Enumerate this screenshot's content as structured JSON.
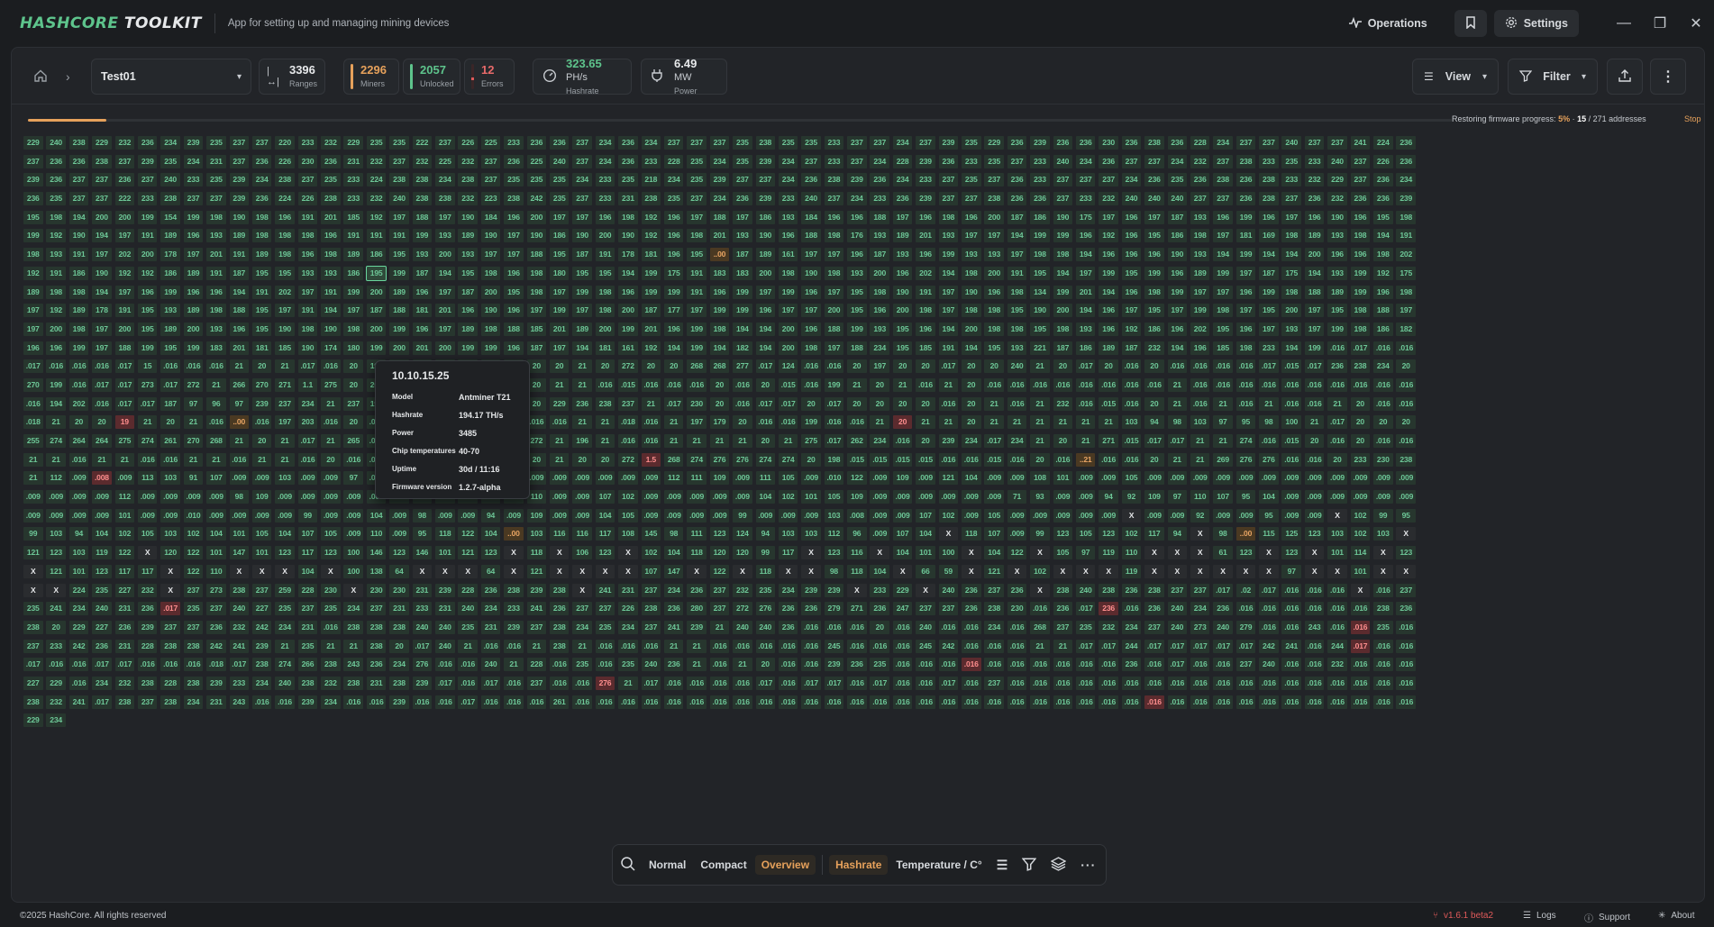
{
  "app": {
    "brand_a": "HASHCORE",
    "brand_b": "TOOLKIT",
    "subtitle": "App for setting up and managing mining devices"
  },
  "topbar": {
    "operations": "Operations",
    "settings": "Settings"
  },
  "header": {
    "project": "Test01",
    "ranges": {
      "num": "3396",
      "label": "Ranges"
    },
    "miners": {
      "num": "2296",
      "label": "Miners"
    },
    "unlocked": {
      "num": "2057",
      "label": "Unlocked"
    },
    "errors": {
      "num": "12",
      "label": "Errors"
    },
    "hashrate": {
      "num": "323.65",
      "unit": "PH/s",
      "label": "Hashrate"
    },
    "power": {
      "num": "6.49",
      "unit": "MW",
      "label": "Power"
    },
    "view": "View",
    "filter": "Filter"
  },
  "progress": {
    "label": "Restoring firmware progress:",
    "percent": "5%",
    "sep": "·",
    "done": "15",
    "total": "/ 271 addresses",
    "fraction": 0.05,
    "stop": "Stop"
  },
  "tooltip": {
    "ip": "10.10.15.25",
    "rows": [
      {
        "k": "Model",
        "v": "Antminer T21"
      },
      {
        "k": "Hashrate",
        "v": "194.17 TH/s"
      },
      {
        "k": "Power",
        "v": "3485"
      },
      {
        "k": "Chip temperatures",
        "v": "40-70"
      },
      {
        "k": "Uptime",
        "v": "30d / 11:16"
      },
      {
        "k": "Firmware version",
        "v": "1.2.7-alpha"
      }
    ]
  },
  "bottombar": {
    "normal": "Normal",
    "compact": "Compact",
    "overview": "Overview",
    "hashrate": "Hashrate",
    "temperature": "Temperature / C°"
  },
  "footer": {
    "copyright": "©2025 HashCore. All rights reserved",
    "version": "v1.6.1 beta2",
    "logs": "Logs",
    "support": "Support",
    "about": "About"
  },
  "grid_rows": [
    "229 240 238 229 232 236 234 239 235 237 237 220 233 232 229 235 235 222 237 226 225 233 236 236 237 234 236 234 237 237 237 235 238 235 235 233 237 237 234 237 239 235 229 236 239 236 236 230 236 238 236 228 234 237 237 240 237 237 241 224 236",
    "237 236 236 238 237 239 235 234 231 237 236 226 230 236 231 232 237 232 225 232 237 236 225 240 237 234 236 233 228 235 234 235 239 234 237 233 237 234 228 239 236 233 235 237 233 240 234 236 237 237 234 232 237 238 233 235 233 240 237 226 236",
    "239 236 237 237 236 237 240 233 235 239 234 238 237 235 233 224 238 238 234 238 237 235 235 235 234 233 235 218 234 235 239 237 237 234 236 238 239 236 234 233 237 235 237 236 233 237 237 237 234 236 235 236 238 236 238 233 232 229 237 236 234",
    "236 235 237 237 222 233 238 237 237 239 236 224 226 238 233 232 240 238 238 232 223 238 242 235 237 233 231 238 235 237 234 236 239 233 240 237 234 233 236 239 237 237 238 236 236 237 233 232 240 240 240 237 237 236 238 237 236 232 236 236 239",
    "195 198 194 200 200 199 154 199 198 190 198 196 191 201 185 192 197 188 197 190 184 196 200 197 197 196 198 192 196 197 188 197 186 193 184 196 196 188 197 196 198 196 200 187 186 190 175 197 196 197 187 193 196 199 196 197 196 190 196 195 198",
    "199 192 190 194 197 191 189 196 193 189 198 198 198 196 191 191 191 199 193 189 190 197 190 186 190 200 190 192 196 198 201 193 190 196 188 198 176 193 189 201 193 197 197 194 199 199 196 192 196 195 186 198 197 181 169 198 189 193 198 194 191",
    "198 193 191 197 202 200 178 197 201 191 189 198 196 198 189 186 195 193 200 193 197 197 188 195 187 191 178 181 196 195 ..00 187 189 161 197 197 196 187 193 196 199 193 193 197 198 198 194 196 196 196 190 193 194 199 194 194 200 196 196 198 202",
    "192 191 186 190 192 192 186 189 191 187 195 195 193 193 186 195 199 187 194 195 198 196 198 180 195 195 194 199 175 191 183 183 200 198 190 198 193 200 196 202 194 198 200 191 195 194 197 199 195 199 196 189 199 197 187 175 194 193 199 192 175",
    "189 198 198 194 197 196 199 196 196 194 191 202 197 191 199 200 189 196 197 187 200 195 198 197 199 198 196 199 199 191 196 199 197 199 196 197 195 198 190 191 197 190 196 198 134 199 201 194 196 198 199 197 197 196 199 198 188 189 199 196 198",
    "197 192 189 178 191 195 193 189 198 188 195 197 191 194 197 187 188 181 201 196 190 196 197 199 197 198 200 187 177 197 199 199 196 197 197 200 195 196 200 198 197 198 198 195 190 200 194 196 197 195 197 199 198 197 195 200 197 195 198 188 197",
    "197 200 198 197 200 195 189 200 193 196 195 190 198 190 198 200 199 196 197 189 198 188 185 201 189 200 199 201 196 199 198 194 194 200 196 188 199 193 195 196 194 200 198 198 195 198 193 196 192 186 196 202 195 196 197 193 197 199 198 186 182",
    "196 196 199 197 188 199 195 199 183 201 181 185 190 174 180 199 200 201 200 199 199 196 187 197 194 181 161 192 194 199 194 182 194 200 198 197 188 234 195 185 191 194 195 193 221 187 186 189 187 232 194 196 185 198 233 194 199 .016 .017 .016 .016",
    ".017 .016 .016 .016 .017 15 .016 .016 .016 21 20 21 .017 .016 20 192 .016 .017 .016 .017 192 .017 20 20 21 20 272 20 20 268 268 277 .017 124 .016 .016 20 197 20 20 .017 20 20 240 21 20 .017 20 .016 20 .016 .016 .016 .016 .017 .015 .017 236 238 234 20",
    "270 199 .016 .017 .017 273 .017 272 21 266 270 271 1.1 275 20 202 203 20 21 20 20 21 20 21 21 .016 .015 .016 .016 .016 20 .016 20 .015 .016 199 21 20 21 .016 21 20 .016 .016 .016 .016 .016 .016 .016 .016 21 .016 .016 .016 .016 .016 .016 .016 .016 .016 .016",
    ".016 194 202 .016 .017 .017 187 97 96 97 239 237 234 21 237 198 196 .016 .016 20 .017 .016 20 229 236 238 237 21 .017 230 20 .016 .017 .017 20 .017 20 20 20 20 .016 20 21 .016 21 232 .016 .015 .016 20 21 .016 21 .016 21 .016 .016 21 20 .016 .016",
    ".018 21 20 20 19 21 20 21 .016 ..00 .016 197 203 .016 20 .016 21 20 .017 20 .017 20 .016 .016 21 21 .018 .016 21 197 179 20 .016 .016 199 .016 .016 21 20 21 21 20 21 21 21 21 21 21 103 94 98 103 97 95 98 100 21 .017 20 20 20",
    "255 274 264 264 275 274 261 270 268 21 20 21 .017 21 265 .016 21 274 21 1.6 273 262 272 21 196 21 .016 .016 21 21 21 21 20 21 275 .017 262 234 .016 20 239 234 .017 234 21 20 21 271 .015 .017 .017 21 21 274 .016 .015 20 .016 20 .016 .016",
    "21 21 .016 21 21 .016 .016 21 21 .016 21 21 .016 20 .016 .016 21 197 .016 20 21 .016 20 21 20 20 272 1.5 268 274 276 276 274 274 20 198 .015 .015 .015 .015 .016 .016 .015 .016 20 .016 ..21 .016 .016 20 21 21 269 276 276 .016 .016 20 233 230 238",
    "21 112 .009 .008 .009 113 103 91 107 .009 .009 103 .009 .009 97 .009 .009 .009 .009 .017 .009 .009 .009 .009 .009 .009 .009 .009 112 111 109 .009 111 105 .009 .010 122 .009 109 .009 121 104 .009 .009 108 101 .009 .009 105 .009 .009 .009 .009 .009 .009 .009 .009 .009 .009 .009 .009",
    ".009 .009 .009 .009 112 .009 .009 .009 .009 98 109 .009 .009 .009 .009 .009 .009 .009 .009 99 .009 110 110 .009 .009 107 102 .009 .009 .009 .009 .009 104 102 101 105 109 .009 .009 .009 .009 .009 .009 71 93 .009 .009 94 92 109 97 110 107 95 104 .009 .009 .009 .009 .009 .009",
    ".009 .009 .009 .009 101 .009 .009 .010 .009 .009 .009 .009 99 .009 .009 104 .009 98 .009 .009 94 .009 109 .009 .009 104 105 .009 .009 .009 .009 99 .009 .009 .009 103 .008 .009 .009 107 102 .009 105 .009 .009 .009 .009 .009 X .009 .009 92 .009 .009 95 .009 .009 X 102 99 95",
    "99 103 94 104 102 105 103 102 104 101 105 104 107 105 .009 110 .009 95 118 122 104 ..00 103 116 116 117 108 145 98 111 123 124 94 103 103 112 96 .009 107 104 X 118 107 .009 99 123 105 123 102 117 94 X 98 ..00 115 125 123 103 102 103 X",
    "121 123 103 119 122 X 120 122 101 147 101 123 117 123 100 146 123 146 101 121 123 X 118 X 106 123 X 102 104 118 120 120 99 117 X 123 116 X 104 101 100 X 104 122 X 105 97 119 110 X X X 61 123 X 123 X 101 114 X 123",
    "X 121 101 123 117 117 X 122 110 X X X 104 X 100 138 64 X X X 64 X 121 X X X X 107 147 X 122 X 118 X X 98 118 104 X 66 59 X 121 X 102 X X X 119 X X X X X X 97 X X 101 X X",
    "X X 224 235 227 232 X 237 273 238 237 259 228 230 X 230 230 231 239 228 236 238 239 238 X 241 231 237 234 236 237 232 235 234 239 239 X 233 229 X 240 236 237 236 X 238 240 238 236 238 237 237 .017 .02 .017 .016 .016 .016 X .016 237",
    "235 241 234 240 231 236 .017 235 237 240 227 235 237 235 234 237 231 233 231 240 234 233 241 236 237 237 226 238 236 280 237 272 276 236 236 279 271 236 247 237 237 236 238 230 .016 236 .017 236 .016 236 240 234 236 .016 .016 .016 .016 .016 .016 238 236",
    "238 20 229 227 236 239 237 237 236 232 242 234 231 .016 238 238 238 240 240 235 231 239 237 238 234 235 234 237 241 239 21 240 240 236 .016 .016 .016 20 .016 240 .016 .016 234 .016 268 237 235 232 234 237 240 273 240 279 .016 .016 243 .016 .016 235 .016",
    "237 233 242 236 231 228 238 238 242 241 239 21 235 21 21 238 20 .017 240 21 .016 .016 21 238 21 .016 .016 .016 21 21 .016 .016 .016 .016 .016 245 .016 .016 .016 245 242 .016 .016 .016 21 21 .017 .017 244 .017 .017 .017 .017 .017 242 241 .016 244 .017 .016 .016",
    ".017 .016 .016 .017 .017 .016 .016 .016 .018 .017 238 274 266 238 243 236 234 276 .016 .016 240 21 228 .016 235 .016 235 240 236 21 .016 21 20 .016 .016 239 236 235 .016 .016 .016 .016 .016 .016 .016 .016 .016 .016 236 .016 .017 .016 .016 237 240 .016 .016 232 .016 .016 .016",
    "227 229 .016 234 232 238 228 238 239 233 234 240 238 232 238 231 238 239 .017 .016 .017 .016 237 .016 .016 276 21 .017 .016 .016 .016 .016 .017 .016 .017 .017 .016 .017 .016 .016 .017 .016 237 .016 .016 .016 .016 .016 .016 .016 .016 .016 .016 .016 .016 .016 .016 .016 .016 .016 .016",
    "238 232 241 .017 238 237 238 234 231 243 .016 .016 239 234 .016 .016 239 .016 .016 .017 .016 .016 .016 261 .016 .016 .016 .016 .016 .016 .016 .016 .016 .016 .016 .016 .016 .016 .016 .016 .016 .016 .016 .016 .016 .016 .016 .016 .016 .016 .016 .016 .016 .016 .016 .016 .016 .016 .016 .016 .016",
    "229 234"
  ],
  "err_cells": [
    "6-30",
    "15-4",
    "15-9",
    "15-38",
    "17-27",
    "18-3",
    "25-6",
    "25-47",
    "26-58",
    "27-58",
    "28-41",
    "29-25",
    "30-49"
  ],
  "warn_cells": [
    "21-21",
    "21-53",
    "15-9"
  ],
  "selected_cell": "7-15"
}
